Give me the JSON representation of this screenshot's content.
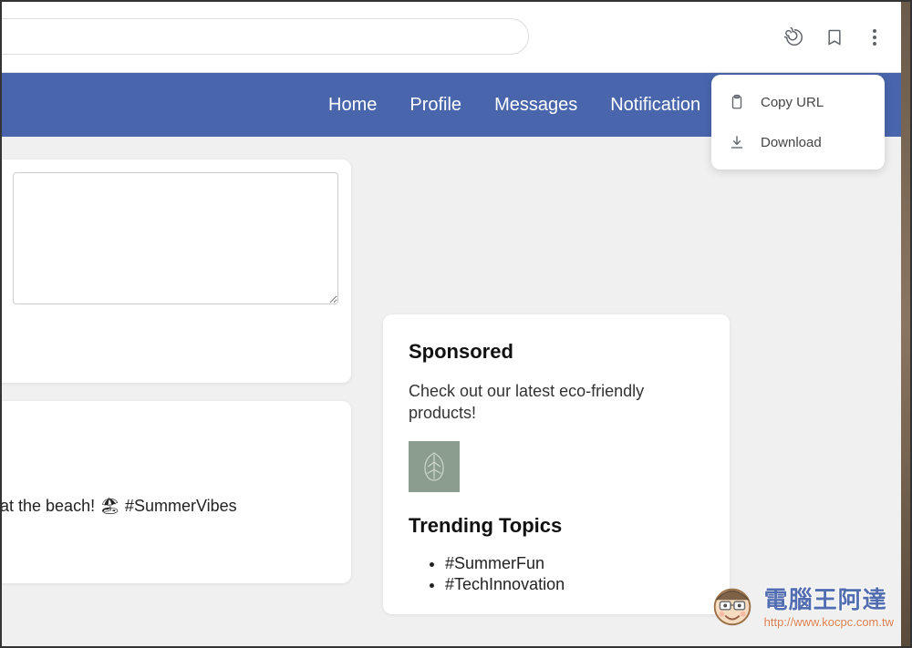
{
  "browser": {
    "menu": {
      "copy_url": "Copy URL",
      "download": "Download"
    }
  },
  "nav": {
    "home": "Home",
    "profile": "Profile",
    "messages": "Messages",
    "notifications": "Notification"
  },
  "post": {
    "text": "at the beach! 🏖 #SummerVibes"
  },
  "sidebar": {
    "sponsored_heading": "Sponsored",
    "sponsored_text": "Check out our latest eco-friendly products!",
    "trending_heading": "Trending Topics",
    "trending": [
      "#SummerFun",
      "#TechInnovation"
    ]
  },
  "watermark": {
    "title": "電腦王阿達",
    "url": "http://www.kocpc.com.tw"
  }
}
